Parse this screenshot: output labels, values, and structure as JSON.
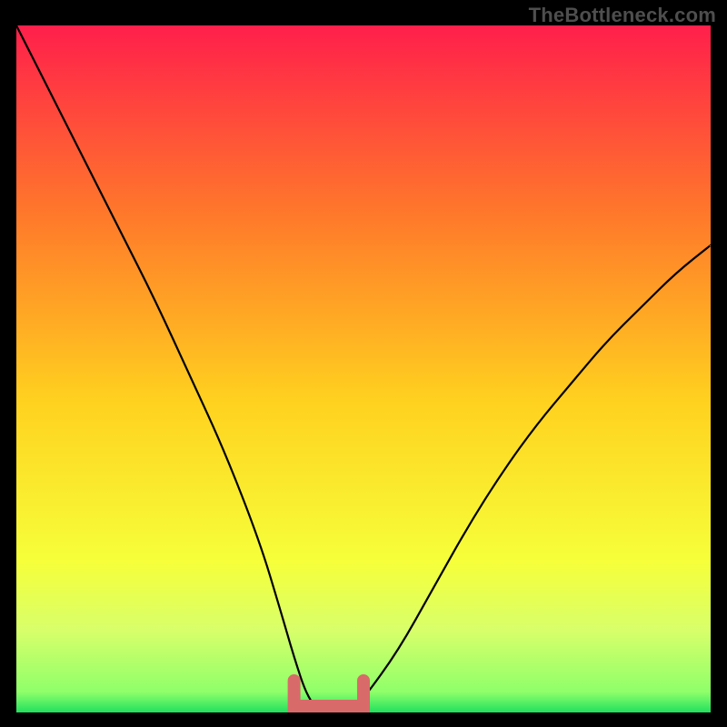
{
  "watermark": "TheBottleneck.com",
  "colors": {
    "bg_black": "#000000",
    "grad_top": "#ff1f4b",
    "grad_mid1": "#ff7a2a",
    "grad_mid2": "#ffd21f",
    "grad_mid3": "#f6ff3a",
    "grad_bottom_band": "#d8ff6a",
    "grad_green": "#22e05e",
    "curve": "#000000",
    "marker": "#d96a6a"
  },
  "chart_data": {
    "type": "line",
    "title": "",
    "xlabel": "",
    "ylabel": "",
    "xlim": [
      0,
      100
    ],
    "ylim": [
      0,
      100
    ],
    "grid": false,
    "series": [
      {
        "name": "bottleneck-curve",
        "x": [
          0,
          5,
          10,
          15,
          20,
          25,
          30,
          35,
          38,
          40,
          42,
          44,
          46,
          48,
          50,
          55,
          60,
          65,
          70,
          75,
          80,
          85,
          90,
          95,
          100
        ],
        "y": [
          100,
          90,
          80,
          70,
          60,
          49,
          38,
          25,
          15,
          8,
          2,
          0,
          0,
          0,
          2,
          9,
          18,
          27,
          35,
          42,
          48,
          54,
          59,
          64,
          68
        ]
      }
    ],
    "annotations": [
      {
        "name": "optimal-range",
        "x_from": 40,
        "x_to": 50,
        "y": 0
      }
    ],
    "background_gradient_stops": [
      {
        "offset": 0.0,
        "color": "#ff1f4b"
      },
      {
        "offset": 0.28,
        "color": "#ff7a2a"
      },
      {
        "offset": 0.55,
        "color": "#ffd21f"
      },
      {
        "offset": 0.78,
        "color": "#f6ff3a"
      },
      {
        "offset": 0.88,
        "color": "#d8ff6a"
      },
      {
        "offset": 0.97,
        "color": "#8fff6a"
      },
      {
        "offset": 1.0,
        "color": "#22e05e"
      }
    ]
  }
}
